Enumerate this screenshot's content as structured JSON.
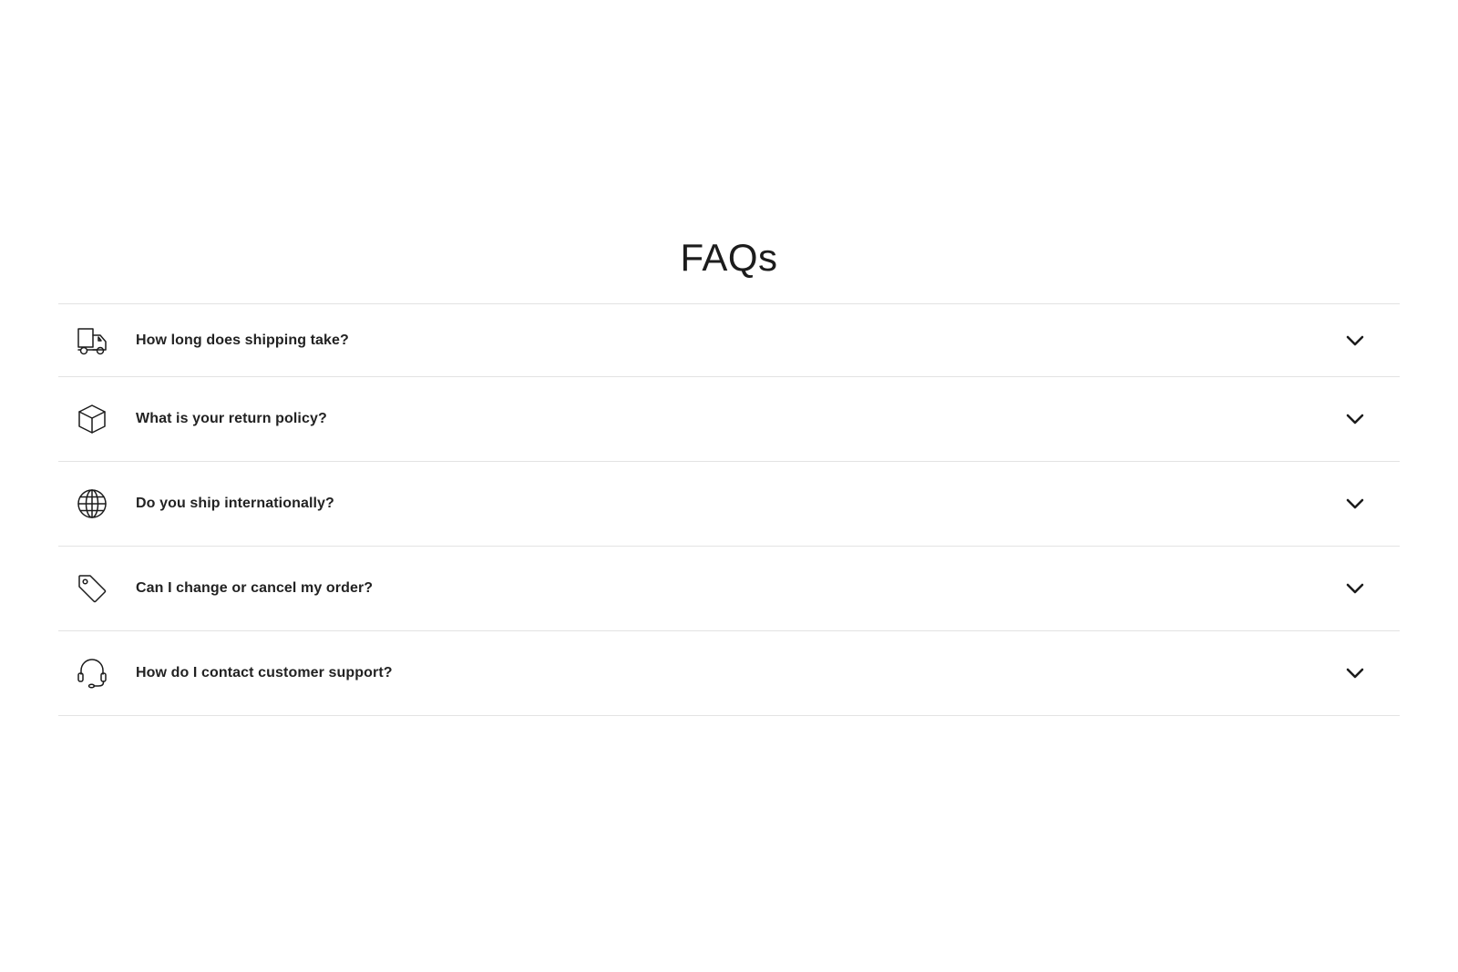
{
  "faq": {
    "title": "FAQs",
    "items": [
      {
        "icon": "truck-icon",
        "question": "How long does shipping take?"
      },
      {
        "icon": "box-icon",
        "question": "What is your return policy?"
      },
      {
        "icon": "globe-icon",
        "question": "Do you ship internationally?"
      },
      {
        "icon": "tag-icon",
        "question": "Can I change or cancel my order?"
      },
      {
        "icon": "headset-icon",
        "question": "How do I contact customer support?"
      }
    ]
  },
  "colors": {
    "text": "#1c1c1c",
    "divider": "#e3e3e3",
    "background": "#ffffff"
  }
}
